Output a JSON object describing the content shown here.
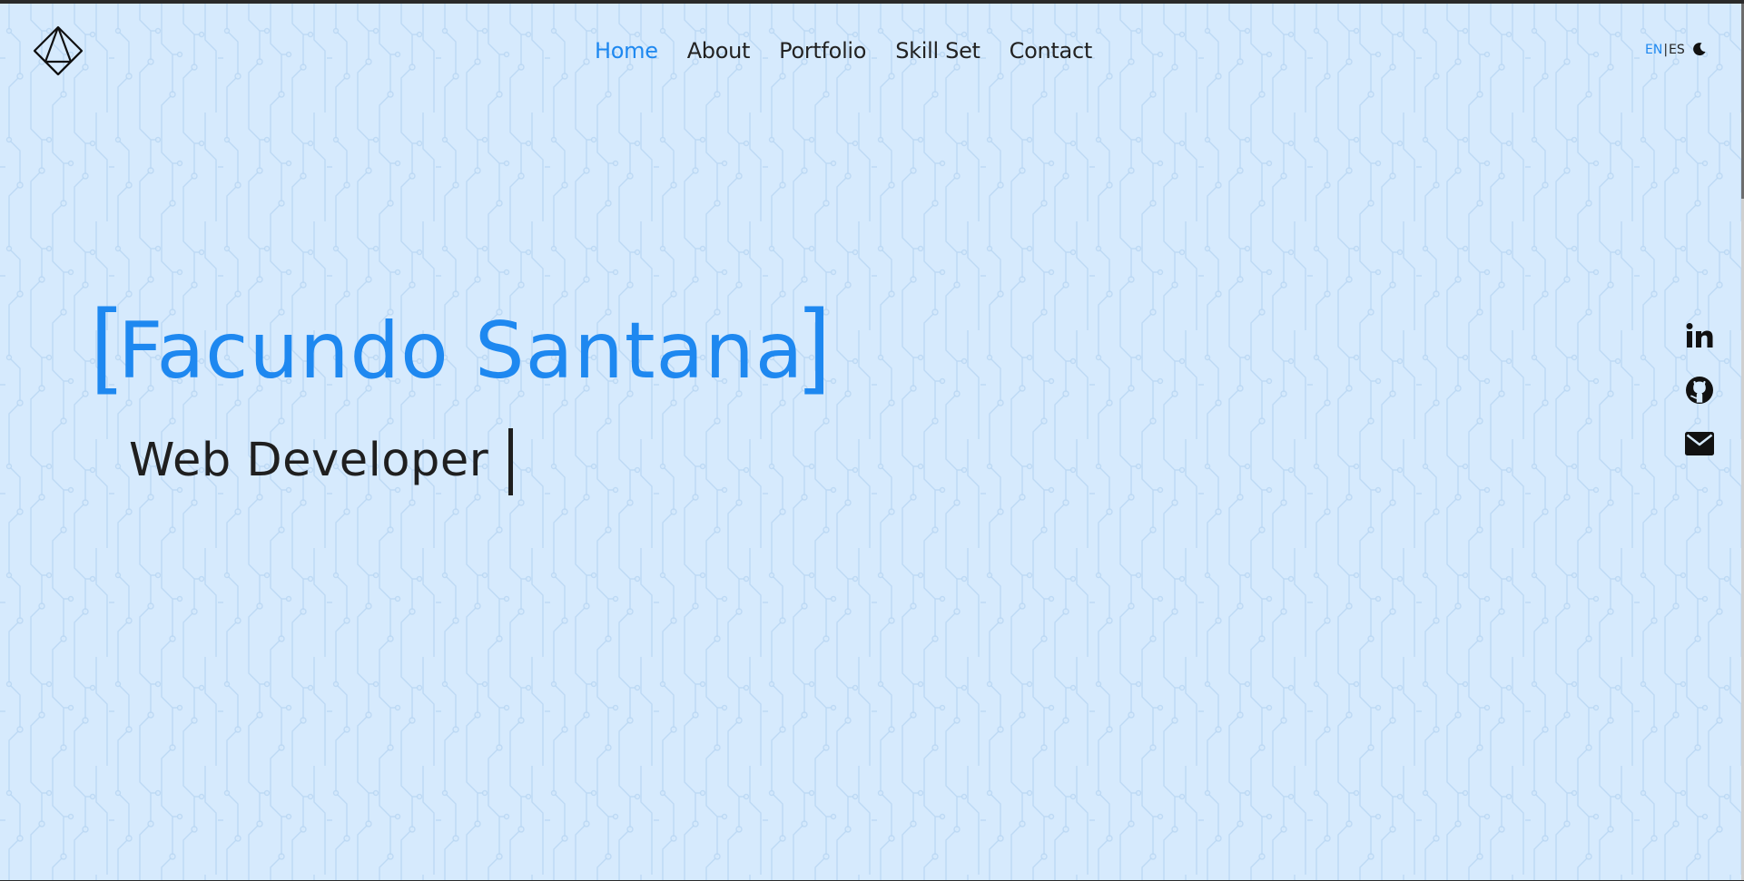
{
  "brand": {
    "logo_icon": "octahedron-logo-icon"
  },
  "nav": {
    "items": [
      {
        "label": "Home",
        "active": true
      },
      {
        "label": "About",
        "active": false
      },
      {
        "label": "Portfolio",
        "active": false
      },
      {
        "label": "Skill Set",
        "active": false
      },
      {
        "label": "Contact",
        "active": false
      }
    ]
  },
  "language": {
    "options": [
      "EN",
      "ES"
    ],
    "separator": "|",
    "selected": "EN"
  },
  "theme_toggle": {
    "icon": "moon-icon"
  },
  "hero": {
    "open_bracket": "[",
    "name": "Facundo Santana",
    "close_bracket": "]",
    "role": "Web Developer"
  },
  "social": [
    {
      "icon": "linkedin-icon"
    },
    {
      "icon": "github-icon"
    },
    {
      "icon": "envelope-icon"
    }
  ],
  "colors": {
    "accent": "#1e88f0",
    "background": "#d6eafd",
    "text": "#222222"
  }
}
